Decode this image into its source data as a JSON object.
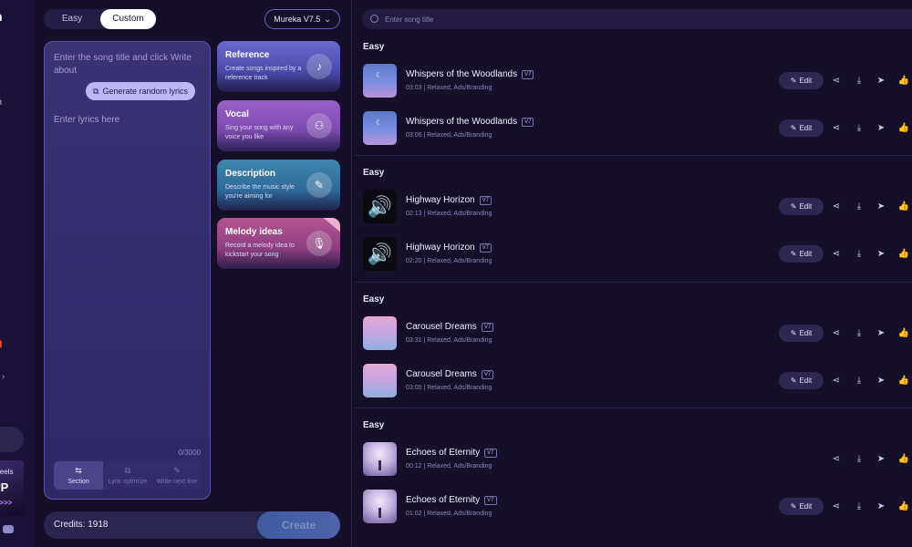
{
  "sidebar": {
    "logo": "n",
    "items": [
      {
        "label": "ic",
        "active": true
      },
      {
        "label": "ech",
        "active": false
      }
    ],
    "gift_text": "its",
    "gift_icon": "🎁",
    "chevron": "›",
    "promo": {
      "line1": "Reels",
      "line2": "PP",
      "line3": "S>>>"
    },
    "discord_icon": "discord-icon"
  },
  "mode": {
    "easy_label": "Easy",
    "custom_label": "Custom",
    "selected": "Custom"
  },
  "model": {
    "label": "Mureka V7.5",
    "chevron": "⌄"
  },
  "lyrics": {
    "title_placeholder": "Enter the song title and click Write about",
    "generate_label": "Generate random lyrics",
    "generate_icon": "⧉",
    "lyrics_placeholder": "Enter lyrics here",
    "char_count": "0/3000",
    "tools": [
      {
        "label": "Section",
        "icon": "⇆",
        "active": true
      },
      {
        "label": "Lyric optimize",
        "icon": "⧉",
        "active": false
      },
      {
        "label": "Write next line",
        "icon": "✎",
        "active": false
      }
    ]
  },
  "features": [
    {
      "key": "ref",
      "title": "Reference",
      "desc": "Create songs inspired by a reference track",
      "icon": "♪"
    },
    {
      "key": "voc",
      "title": "Vocal",
      "desc": "Sing your song with any voice you like",
      "icon": "⚇"
    },
    {
      "key": "des",
      "title": "Description",
      "desc": "Describe the music style you're aiming for",
      "icon": "✎"
    },
    {
      "key": "mel",
      "title": "Melody ideas",
      "desc": "Record a melody idea to kickstart your song",
      "icon": "🎙"
    }
  ],
  "credits": {
    "text": "Credits: 1918",
    "create_label": "Create"
  },
  "search": {
    "placeholder": "Enter song title"
  },
  "groups": [
    {
      "label": "Easy",
      "songs": [
        {
          "title": "Whispers of the Woodlands",
          "version": "V7",
          "meta": "03:03 | Relaxed, Ads/Branding",
          "thumb": "woods",
          "edit": true
        },
        {
          "title": "Whispers of the Woodlands",
          "version": "V7",
          "meta": "03:06 | Relaxed, Ads/Branding",
          "thumb": "woods",
          "edit": true
        }
      ]
    },
    {
      "label": "Easy",
      "songs": [
        {
          "title": "Highway Horizon",
          "version": "V7",
          "meta": "02:13 | Relaxed, Ads/Branding",
          "thumb": "speaker",
          "edit": true
        },
        {
          "title": "Highway Horizon",
          "version": "V7",
          "meta": "02:20 | Relaxed, Ads/Branding",
          "thumb": "speaker",
          "edit": true
        }
      ]
    },
    {
      "label": "Easy",
      "songs": [
        {
          "title": "Carousel Dreams",
          "version": "V7",
          "meta": "03:31 | Relaxed, Ads/Branding",
          "thumb": "carousel",
          "edit": true
        },
        {
          "title": "Carousel Dreams",
          "version": "V7",
          "meta": "03:00 | Relaxed, Ads/Branding",
          "thumb": "carousel",
          "edit": true
        }
      ]
    },
    {
      "label": "Easy",
      "songs": [
        {
          "title": "Echoes of Eternity",
          "version": "V7",
          "meta": "00:12 | Relaxed, Ads/Branding",
          "thumb": "eternity",
          "edit": false
        },
        {
          "title": "Echoes of Eternity",
          "version": "V7",
          "meta": "01:02 | Relaxed, Ads/Branding",
          "thumb": "eternity",
          "edit": true
        }
      ]
    }
  ],
  "row_actions": {
    "edit_label": "Edit",
    "edit_icon": "✎",
    "share_icon": "⋖",
    "download_icon": "⤓",
    "send_icon": "➤",
    "like_icon": "👍"
  }
}
